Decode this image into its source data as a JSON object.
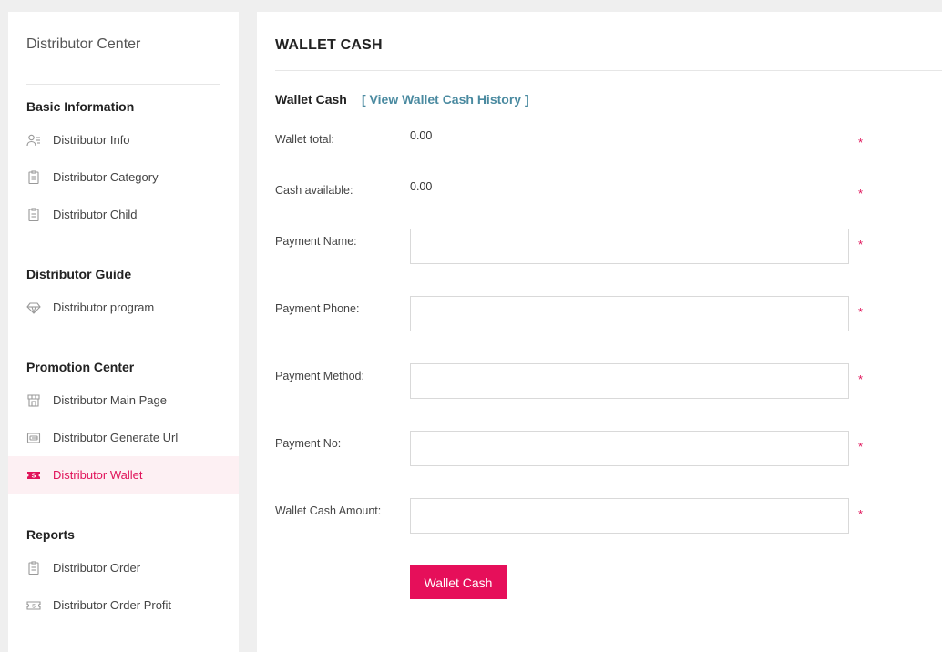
{
  "sidebar": {
    "title": "Distributor Center",
    "sections": [
      {
        "heading": "Basic Information",
        "items": [
          {
            "label": "Distributor Info",
            "icon": "user-list-icon"
          },
          {
            "label": "Distributor Category",
            "icon": "document-icon"
          },
          {
            "label": "Distributor Child",
            "icon": "document-icon"
          }
        ]
      },
      {
        "heading": "Distributor Guide",
        "items": [
          {
            "label": "Distributor program",
            "icon": "diamond-icon"
          }
        ]
      },
      {
        "heading": "Promotion Center",
        "items": [
          {
            "label": "Distributor Main Page",
            "icon": "storefront-icon"
          },
          {
            "label": "Distributor Generate Url",
            "icon": "link-card-icon"
          },
          {
            "label": "Distributor Wallet",
            "icon": "wallet-icon",
            "active": true
          }
        ]
      },
      {
        "heading": "Reports",
        "items": [
          {
            "label": "Distributor Order",
            "icon": "document-icon"
          },
          {
            "label": "Distributor Order Profit",
            "icon": "ticket-icon"
          }
        ]
      }
    ]
  },
  "main": {
    "title": "WALLET CASH",
    "subtitle": "Wallet Cash",
    "history_link": "[ View Wallet Cash History ]",
    "fields": {
      "wallet_total": {
        "label": "Wallet total:",
        "value": "0.00"
      },
      "cash_available": {
        "label": "Cash available:",
        "value": "0.00"
      },
      "payment_name": {
        "label": "Payment Name:",
        "value": ""
      },
      "payment_phone": {
        "label": "Payment Phone:",
        "value": ""
      },
      "payment_method": {
        "label": "Payment Method:",
        "value": ""
      },
      "payment_no": {
        "label": "Payment No:",
        "value": ""
      },
      "wallet_cash_amount": {
        "label": "Wallet Cash Amount:",
        "value": ""
      }
    },
    "required_mark": "*",
    "submit_label": "Wallet Cash"
  },
  "colors": {
    "accent": "#e60f5a",
    "link": "#4a8aa0",
    "active_bg": "#fdf0f3",
    "page_bg": "#efefef"
  }
}
